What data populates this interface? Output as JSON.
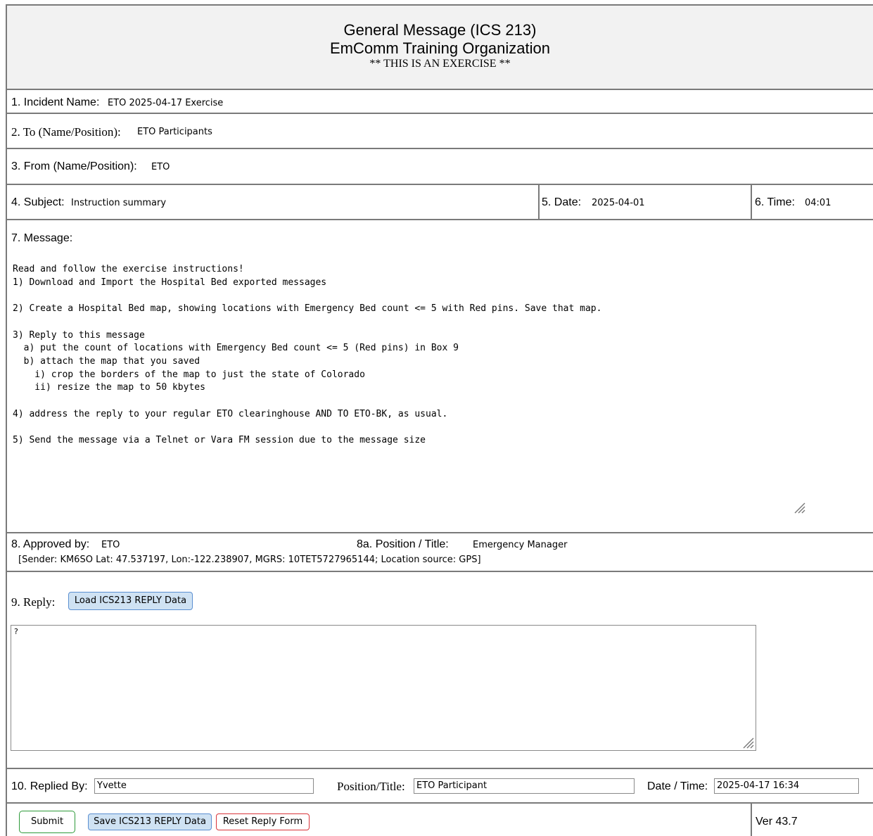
{
  "header": {
    "title": "General Message (ICS 213)",
    "organization": "EmComm Training Organization",
    "exercise_note": "** THIS IS AN EXERCISE **"
  },
  "incident": {
    "label": "1. Incident Name:",
    "value": "ETO 2025-04-17 Exercise"
  },
  "to": {
    "label": "2. To (Name/Position):",
    "value": "ETO Participants"
  },
  "from": {
    "label": "3. From (Name/Position):",
    "value": "ETO"
  },
  "subject": {
    "label": "4. Subject:",
    "value": "Instruction summary"
  },
  "date": {
    "label": "5. Date:",
    "value": "2025-04-01"
  },
  "time": {
    "label": "6. Time:",
    "value": "04:01"
  },
  "message": {
    "label": "7. Message:",
    "lines": [
      "Read and follow the exercise instructions!",
      "1) Download and Import the Hospital Bed exported messages",
      "",
      "2) Create a Hospital Bed map, showing locations with Emergency Bed count <= 5 with Red pins. Save that map.",
      "",
      "3) Reply to this message",
      "  a) put the count of locations with Emergency Bed count <= 5 (Red pins) in Box 9",
      "  b) attach the map that you saved",
      "    i) crop the borders of the map to just the state of Colorado",
      "    ii) resize the map to 50 kbytes",
      "",
      "4) address the reply to your regular ETO clearinghouse AND TO ETO-BK, as usual.",
      "",
      "5) Send the message via a Telnet or Vara FM session due to the message size"
    ]
  },
  "approved": {
    "label": "8. Approved by:",
    "value": "ETO",
    "position_label": "8a. Position / Title:",
    "position_value": "Emergency Manager",
    "sender_info": "[Sender: KM6SO Lat: 47.537197, Lon:-122.238907, MGRS: 10TET5727965144; Location source: GPS]"
  },
  "reply": {
    "label": "9. Reply:",
    "load_button": "Load ICS213 REPLY Data",
    "text": "?"
  },
  "replied": {
    "label": "10. Replied By:",
    "value": "Yvette",
    "position_label": "Position/Title:",
    "position_value": "ETO Participant",
    "datetime_label": "Date / Time:",
    "datetime_value": "2025-04-17 16:34"
  },
  "footer": {
    "submit": "Submit",
    "save": "Save ICS213 REPLY Data",
    "reset": "Reset Reply Form",
    "version": "Ver 43.7"
  }
}
